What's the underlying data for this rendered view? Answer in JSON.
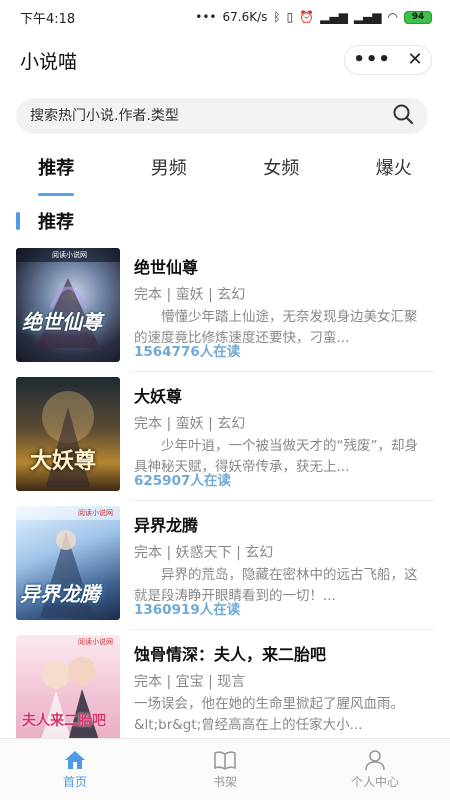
{
  "status_bar": {
    "time": "下午4:18",
    "network_speed": "67.6K/s",
    "battery": "94"
  },
  "title_bar": {
    "title": "小说喵",
    "more_icon": "ellipsis-icon",
    "close_icon": "close-icon"
  },
  "search": {
    "placeholder": "搜索热门小说.作者.类型",
    "icon": "search-icon"
  },
  "tabs": [
    {
      "label": "推荐",
      "active": true
    },
    {
      "label": "男频",
      "active": false
    },
    {
      "label": "女频",
      "active": false
    },
    {
      "label": "爆火",
      "active": false
    }
  ],
  "section": {
    "title": "推荐"
  },
  "books": [
    {
      "title": "绝世仙尊",
      "meta": "完本 | 蛮妖 | 玄幻",
      "desc": "懵懂少年踏上仙途，无奈发现身边美女汇聚的速度竟比修炼速度还要快，刁蛮...",
      "readers": "1564776人在读",
      "cover_text": "绝世仙尊",
      "cover_badge": "阅读小说网"
    },
    {
      "title": "大妖尊",
      "meta": "完本 | 蛮妖 | 玄幻",
      "desc": "少年叶逍，一个被当做天才的“残废”，却身具神秘天赋，得妖帝传承，获无上...",
      "readers": "625907人在读",
      "cover_text": "大妖尊",
      "cover_badge": ""
    },
    {
      "title": "异界龙腾",
      "meta": "完本 | 妖惑天下 | 玄幻",
      "desc": "异界的荒岛，隐藏在密林中的远古飞船，这就是段涛睁开眼睛看到的一切！...",
      "readers": "1360919人在读",
      "cover_text": "异界龙腾",
      "cover_badge": "阅读小说网"
    },
    {
      "title": "蚀骨情深：夫人，来二胎吧",
      "meta": "完本 | 宜宝 | 现言",
      "desc": "一场误会，他在她的生命里掀起了腥风血雨。&lt;br&gt;曾经高高在上的任家大小...",
      "readers": "",
      "cover_text": "夫人来二胎吧",
      "cover_badge": "阅读小说网"
    }
  ],
  "bottom_nav": [
    {
      "label": "首页",
      "icon": "home-icon",
      "active": true
    },
    {
      "label": "书架",
      "icon": "bookshelf-icon",
      "active": false
    },
    {
      "label": "个人中心",
      "icon": "user-icon",
      "active": false
    }
  ]
}
